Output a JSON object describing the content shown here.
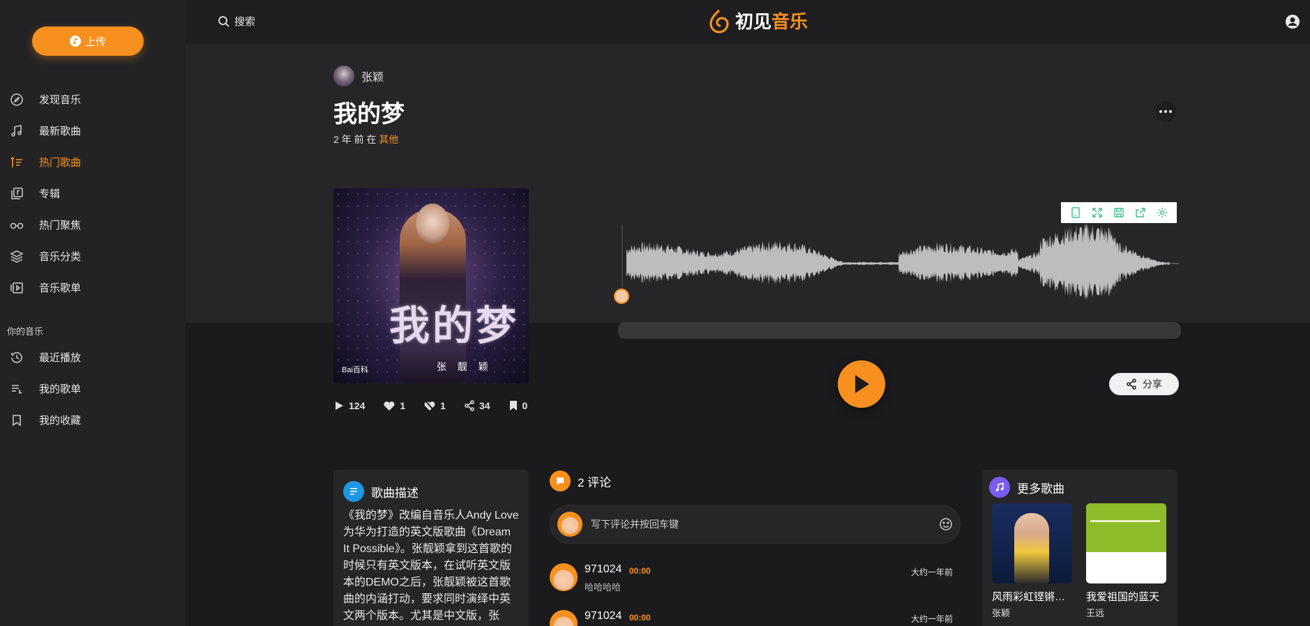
{
  "app": {
    "logo_part1": "初见",
    "logo_part2": "音乐"
  },
  "colors": {
    "accent": "#f7901e",
    "bg": "#1b1b1d",
    "sidebar": "#232325"
  },
  "sidebar": {
    "upload_label": "上传",
    "items": [
      {
        "label": "发现音乐",
        "icon": "compass-icon"
      },
      {
        "label": "最新歌曲",
        "icon": "music-note-icon"
      },
      {
        "label": "热门歌曲",
        "icon": "sort-icon",
        "active": true
      },
      {
        "label": "专辑",
        "icon": "album-icon"
      },
      {
        "label": "热门聚焦",
        "icon": "glasses-icon"
      },
      {
        "label": "音乐分类",
        "icon": "layers-icon"
      },
      {
        "label": "音乐歌单",
        "icon": "playlist-icon"
      }
    ],
    "section_label": "你的音乐",
    "my_items": [
      {
        "label": "最近播放",
        "icon": "history-icon"
      },
      {
        "label": "我的歌单",
        "icon": "list-icon"
      },
      {
        "label": "我的收藏",
        "icon": "bookmark-icon"
      }
    ]
  },
  "topbar": {
    "search_label": "搜索"
  },
  "song": {
    "artist": "张颖",
    "title": "我的梦",
    "meta_prefix": "2 年 前 在",
    "category": "其他",
    "cover_text": "我的梦",
    "cover_artist": "张 靓 颖",
    "cover_brand": "Bai百科",
    "stats": {
      "plays": "124",
      "likes": "1",
      "dislikes": "1",
      "shares": "34",
      "bookmarks": "0"
    },
    "share_label": "分享"
  },
  "description": {
    "title": "歌曲描述",
    "text": "《我的梦》改编自音乐人Andy Love为华为打造的英文版歌曲《Dream It Possible》。张靓颖拿到这首歌的时候只有英文版本，在试听英文版本的DEMO之后，张靓颖被这首歌曲的内涵打动，要求同时演绎中英文两个版本。尤其是中文版，张"
  },
  "comments": {
    "count_label": "2 评论",
    "placeholder": "写下评论并按回车键",
    "items": [
      {
        "name": "971024",
        "time": "00:00",
        "text": "哈哈哈哈",
        "date": "大约一年前"
      },
      {
        "name": "971024",
        "time": "00:00",
        "text": "",
        "date": "大约一年前"
      }
    ]
  },
  "more_songs": {
    "title": "更多歌曲",
    "items": [
      {
        "title": "风雨彩虹铿锵玫瑰",
        "artist": "张颖"
      },
      {
        "title": "我爱祖国的蓝天",
        "artist": "王远"
      }
    ]
  }
}
